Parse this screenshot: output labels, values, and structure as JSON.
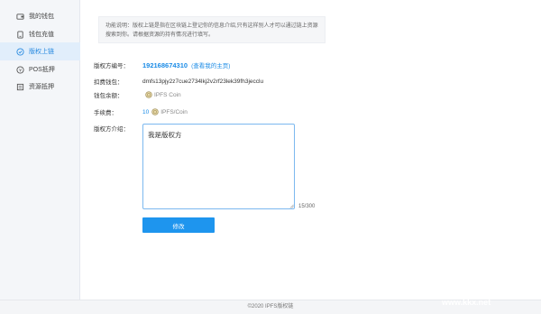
{
  "sidebar": {
    "items": [
      {
        "label": "我的钱包",
        "icon": "wallet-icon"
      },
      {
        "label": "钱包充值",
        "icon": "recharge-icon"
      },
      {
        "label": "版权上链",
        "icon": "copyright-chain-icon",
        "active": true
      },
      {
        "label": "POS抵押",
        "icon": "pos-icon"
      },
      {
        "label": "资源抵押",
        "icon": "resource-icon"
      }
    ]
  },
  "notice": {
    "text": "功能说明：版权上链是指在区块链上登记你的信息介绍,只有这样别人才可以通过链上资源搜索到你。请根据资源的持有情况进行填写。"
  },
  "form": {
    "owner_id_label": "版权方编号：",
    "owner_id_value": "192168674310",
    "owner_id_link": "(查看我的主页)",
    "deduct_wallet_label": "扣费钱包：",
    "deduct_wallet_value": "dmfs13pjy2z7cue2734lkj2v2rf23lek39fh3jecclu",
    "balance_label": "钱包余额：",
    "balance_unit": "IPFS Coin",
    "fee_label": "手续费：",
    "fee_value": "10",
    "fee_unit": "IPFS/Coin",
    "intro_label": "版权方介绍：",
    "intro_value": "我是版权方",
    "intro_counter": "15/300",
    "submit_label": "修改"
  },
  "footer": {
    "text": "©2020 IPFS版权链"
  },
  "watermark": {
    "text": "KK下载",
    "url": "www.kkx.net"
  },
  "colors": {
    "accent": "#1e95ee",
    "sidebar_bg": "#f4f6f9",
    "active_bg": "#e1eefb"
  }
}
